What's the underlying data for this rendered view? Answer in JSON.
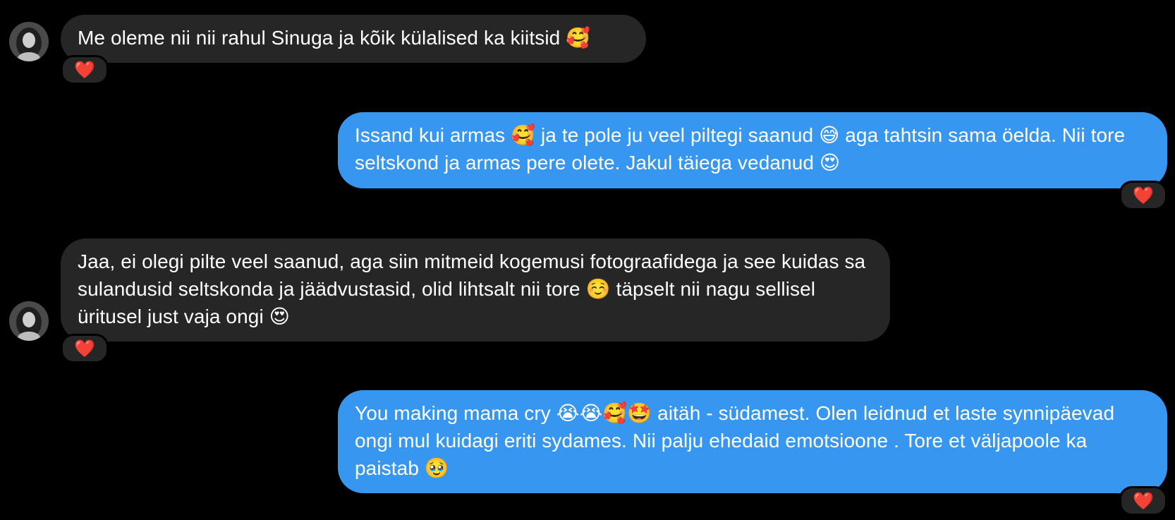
{
  "conversation": {
    "messages": [
      {
        "id": 1,
        "direction": "incoming",
        "text": "Me oleme nii nii rahul Sinuga ja kõik külalised ka kiitsid 🥰",
        "reaction": "❤️"
      },
      {
        "id": 2,
        "direction": "outgoing",
        "text": "Issand kui armas 🥰 ja te pole ju veel piltegi saanud 😅 aga tahtsin sama öelda. Nii tore seltskond ja armas pere olete. Jakul täiega vedanud 😍",
        "reaction": "❤️"
      },
      {
        "id": 3,
        "direction": "incoming",
        "text": "Jaa, ei olegi pilte veel saanud, aga siin mitmeid kogemusi fotograafidega ja see kuidas sa sulandusid seltskonda ja jäädvustasid, olid lihtsalt nii tore ☺️ täpselt nii nagu sellisel üritusel just vaja ongi 😍",
        "reaction": "❤️"
      },
      {
        "id": 4,
        "direction": "outgoing",
        "text": "You making mama cry 😭😭🥰🤩 aitäh - südamest. Olen leidnud et laste synnipäevad ongi mul kuidagi eriti sydames. Nii palju ehedaid emotsioone . Tore et väljapoole ka paistab 🥹",
        "reaction": "❤️"
      }
    ]
  },
  "colors": {
    "background": "#000000",
    "incoming_bubble": "#262626",
    "outgoing_bubble": "#3797f0",
    "reaction_heart": "#ff3040"
  },
  "icons": {
    "avatar": "contact-avatar-photo",
    "reaction": "red-heart-icon"
  }
}
